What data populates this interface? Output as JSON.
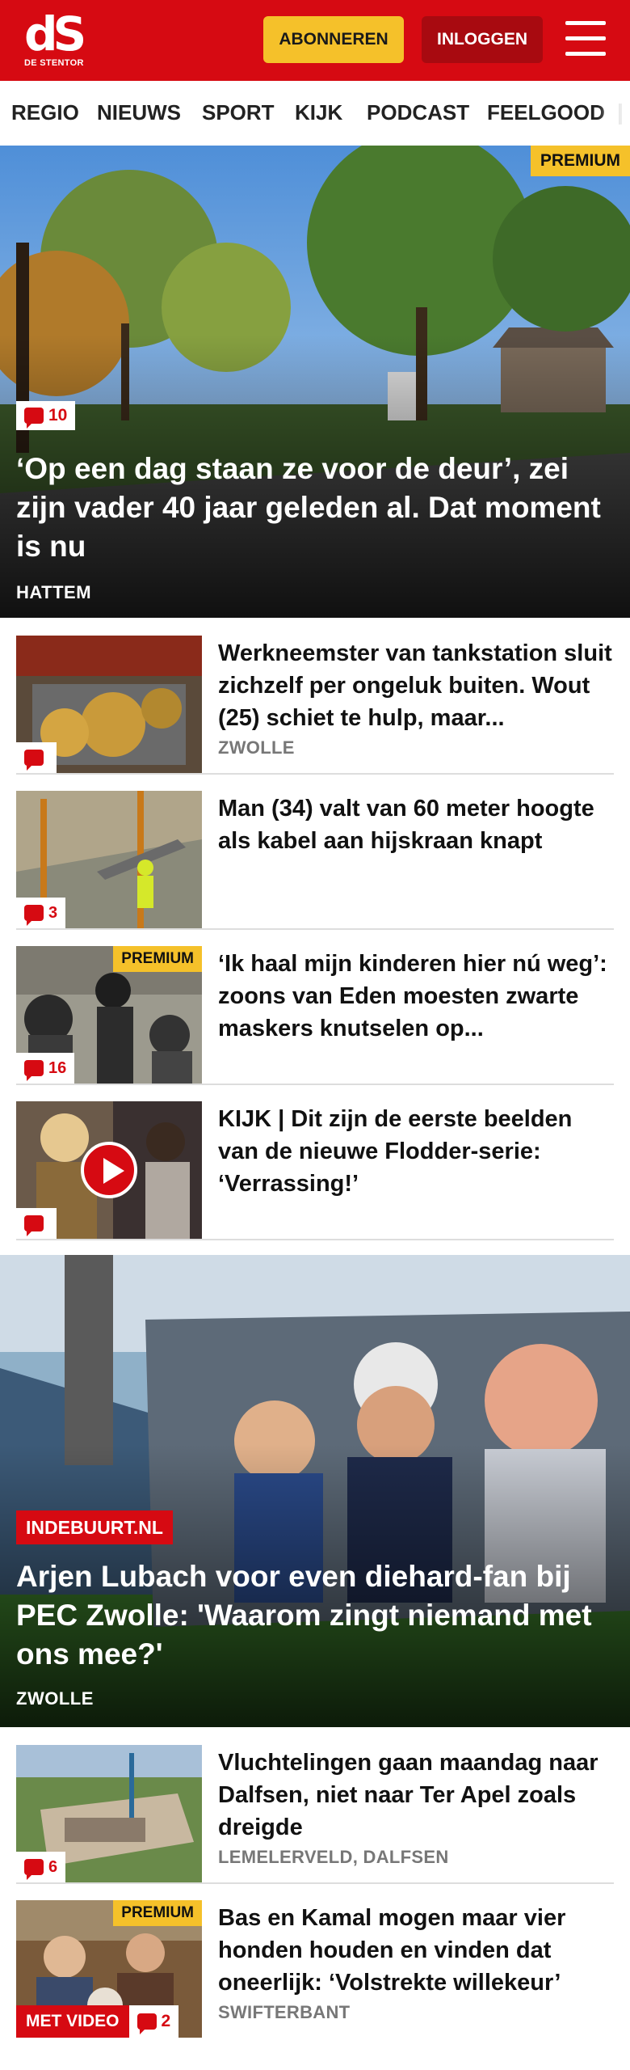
{
  "header": {
    "logo_mark": "dS",
    "logo_sub": "DE STENTOR",
    "subscribe_label": "ABONNEREN",
    "login_label": "INLOGGEN"
  },
  "nav": {
    "items": [
      "REGIO",
      "NIEUWS",
      "SPORT",
      "KIJK",
      "PODCAST",
      "FEELGOOD"
    ]
  },
  "hero1": {
    "premium": "PREMIUM",
    "comments": "10",
    "title": "‘Op een dag staan ze voor de deur’, zei zijn vader 40 jaar geleden al. Dat moment is nu",
    "location": "HATTEM"
  },
  "articles": [
    {
      "title": "Werkneemster van tankstation sluit zichzelf per ongeluk buiten. Wout (25) schiet te hulp, maar...",
      "location": "ZWOLLE",
      "comments": ""
    },
    {
      "title": "Man (34) valt van 60 meter hoogte als kabel aan hijskraan knapt",
      "location": "",
      "comments": "3"
    },
    {
      "title": "‘Ik haal mijn kinderen hier nú weg’: zoons van Eden moesten zwarte maskers knutselen op...",
      "location": "",
      "comments": "16",
      "premium": "PREMIUM"
    },
    {
      "title": "KIJK | Dit zijn de eerste beelden van de nieuwe Flodder-serie: ‘Verrassing!’",
      "location": "",
      "comments": ""
    }
  ],
  "hero2": {
    "tag": "INDEBUURT.NL",
    "title": "Arjen Lubach voor even diehard-fan bij PEC Zwolle: 'Waarom zingt niemand met ons mee?'",
    "location": "ZWOLLE"
  },
  "articles2": [
    {
      "title": "Vluchtelingen gaan maandag naar Dalfsen, niet naar Ter Apel zoals dreigde",
      "location": "LEMELERVELD, DALFSEN",
      "comments": "6"
    },
    {
      "title": "Bas en Kamal mogen maar vier honden houden en vinden dat oneerlijk: ‘Volstrekte willekeur’",
      "location": "SWIFTERBANT",
      "comments": "2",
      "premium": "PREMIUM",
      "video": "MET VIDEO"
    }
  ],
  "colors": {
    "brand": "#d60a12",
    "premium": "#f5c12a",
    "dark_red": "#a80a10"
  },
  "icons": [
    "menu-icon",
    "comment-icon",
    "play-icon"
  ]
}
